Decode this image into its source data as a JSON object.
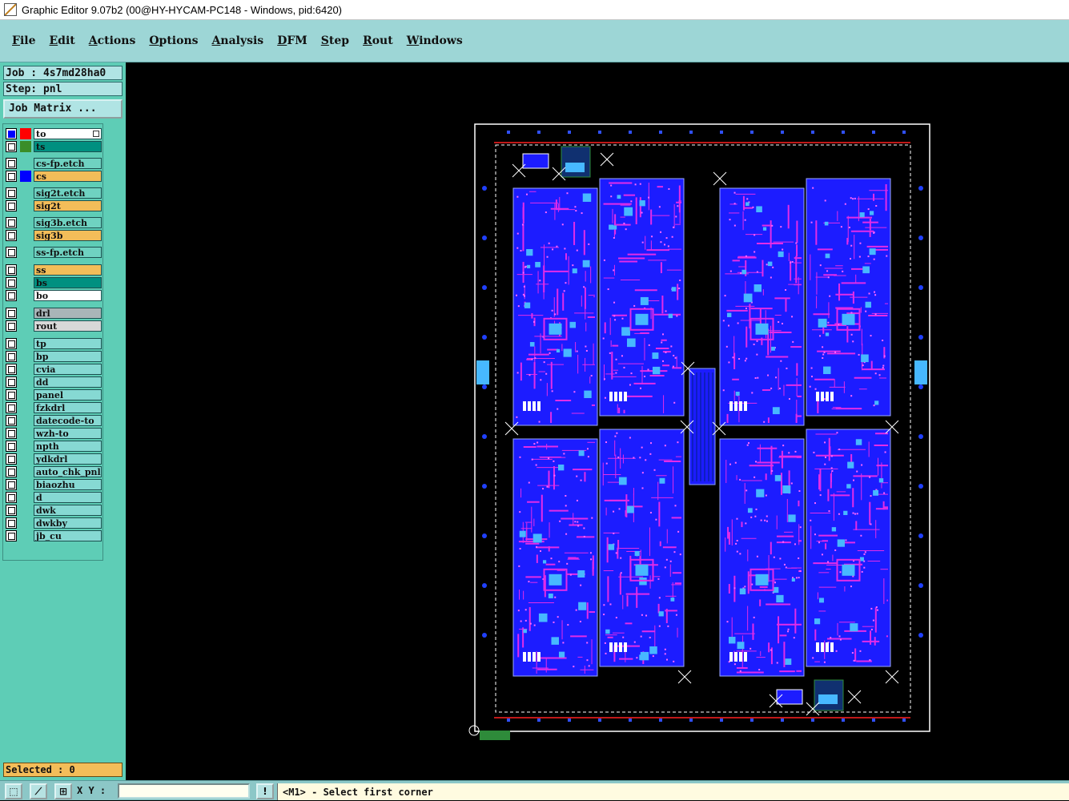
{
  "window": {
    "title": "Graphic Editor 9.07b2 (00@HY-HYCAM-PC148 - Windows, pid:6420)"
  },
  "menu": [
    "File",
    "Edit",
    "Actions",
    "Options",
    "Analysis",
    "DFM",
    "Step",
    "Rout",
    "Windows"
  ],
  "job": {
    "label": "Job : 4s7md28ha0"
  },
  "step": {
    "label": "Step: pnl"
  },
  "job_matrix": {
    "label": "Job Matrix ..."
  },
  "layers": [
    {
      "name": "to",
      "color": "#ffffff",
      "swatch": "#ff0000",
      "active": true,
      "marker": true
    },
    {
      "name": "ts",
      "color": "#009080",
      "swatch": "#3a8d28"
    },
    {
      "name": "cs-fp.etch",
      "color": "#6fd2c1"
    },
    {
      "name": "cs",
      "color": "#f3bd59",
      "swatch": "#0000ff"
    },
    {
      "name": "sig2t.etch",
      "color": "#6fd2c1"
    },
    {
      "name": "sig2t",
      "color": "#f3bd59"
    },
    {
      "name": "sig3b.etch",
      "color": "#6fd2c1"
    },
    {
      "name": "sig3b",
      "color": "#f3bd59"
    },
    {
      "name": "ss-fp.etch",
      "color": "#6fd2c1"
    },
    {
      "name": "ss",
      "color": "#f3bd59"
    },
    {
      "name": "bs",
      "color": "#009080"
    },
    {
      "name": "bo",
      "color": "#ffffff"
    },
    {
      "name": "drl",
      "color": "#a9b5b8"
    },
    {
      "name": "rout",
      "color": "#d8d8d8"
    },
    {
      "name": "tp",
      "color": "#86d9d3"
    },
    {
      "name": "bp",
      "color": "#86d9d3"
    },
    {
      "name": "cvia",
      "color": "#86d9d3"
    },
    {
      "name": "dd",
      "color": "#86d9d3"
    },
    {
      "name": "panel",
      "color": "#86d9d3"
    },
    {
      "name": "fzkdrl",
      "color": "#86d9d3"
    },
    {
      "name": "datecode-to",
      "color": "#86d9d3"
    },
    {
      "name": "wzh-to",
      "color": "#86d9d3"
    },
    {
      "name": "npth",
      "color": "#86d9d3"
    },
    {
      "name": "ydkdrl",
      "color": "#86d9d3"
    },
    {
      "name": "auto_chk_pnl",
      "color": "#86d9d3"
    },
    {
      "name": "biaozhu",
      "color": "#86d9d3"
    },
    {
      "name": "d",
      "color": "#86d9d3"
    },
    {
      "name": "dwk",
      "color": "#86d9d3"
    },
    {
      "name": "dwkby",
      "color": "#86d9d3"
    },
    {
      "name": "jb_cu",
      "color": "#86d9d3"
    }
  ],
  "selected": {
    "label": "Selected : 0"
  },
  "bottom": {
    "tools": [
      "zoom-box-icon",
      "zoom-diagonal-icon",
      "snap-grid-icon"
    ],
    "xy_label": "X Y :",
    "xy_value": "",
    "alert_label": "!",
    "status": "<M1> - Select first corner"
  },
  "colors": {
    "board_fill": "#1c1cff",
    "trace": "#e22ce8",
    "pad": "#47b8ff",
    "frame_line": "#ffffff",
    "red_line": "#ff2020"
  }
}
